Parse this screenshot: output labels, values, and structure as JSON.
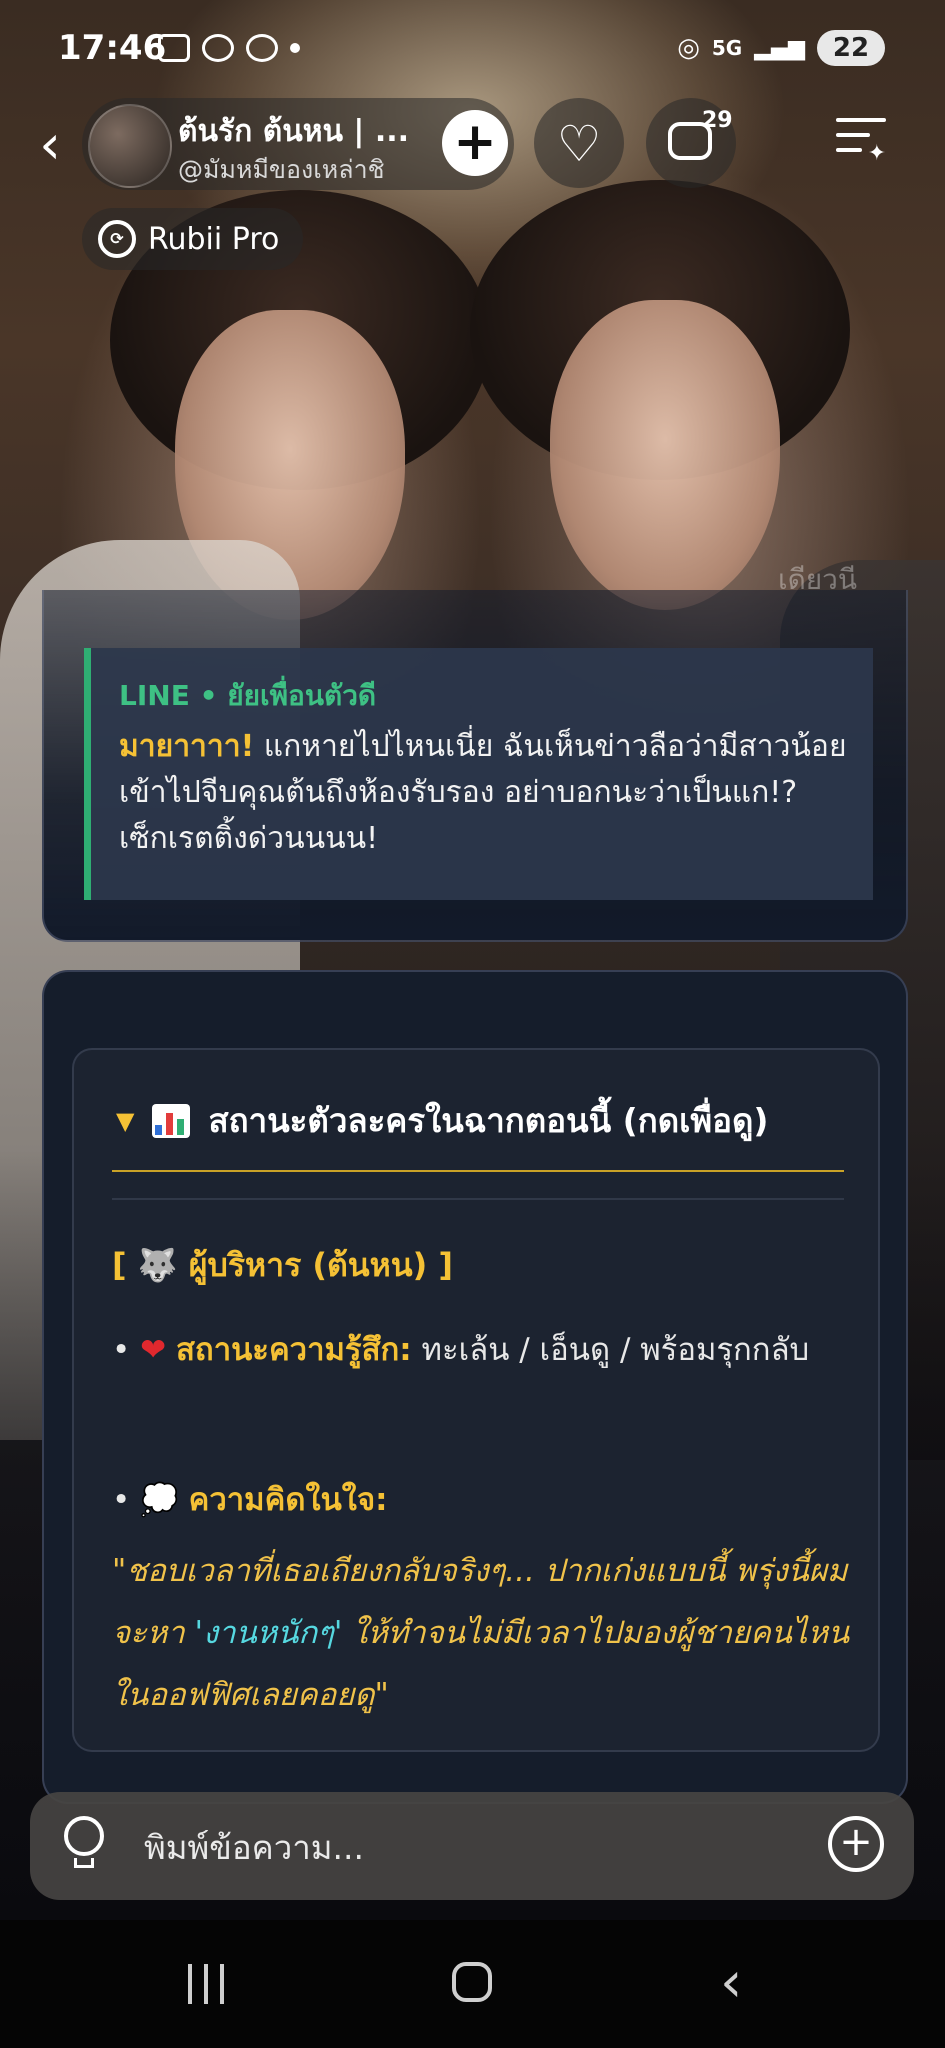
{
  "status_bar": {
    "time": "17:46",
    "network": "5G",
    "battery": "22"
  },
  "header": {
    "back_glyph": "‹",
    "character_name": "ต้นรัก ต้นหน | ...",
    "creator_handle": "@มัมหมีของเหล่าชิ",
    "add_glyph": "+",
    "comment_count": "29",
    "badge_label": "Rubii Pro"
  },
  "watermark": "เดียวนี",
  "message_card": {
    "quote_header": "LINE • ยัยเพื่อนตัวดี",
    "quote_emphasis": "มายาาาา!",
    "quote_body": " แกหายไปไหนเนี่ย ฉันเห็นข่าวลือว่ามีสาวน้อยเข้าไปจีบคุณต้นถึงห้องรับรอง อย่าบอกนะว่าเป็นแก!? เซ็กเรตติ้งด่วนนนน!"
  },
  "status_card": {
    "summary_label": "สถานะตัวละครในฉากตอนนี้ (กดเพื่อดู)",
    "role_line": "[ 🐺 ผู้บริหาร (ต้นหน) ]",
    "bullet": "•",
    "feeling_label": "สถานะความรู้สึก:",
    "feeling_value": " ทะเล้น / เอ็นดู / พร้อมรุกกลับ",
    "thought_label": "ความคิดในใจ:",
    "thought_part1": "\"ชอบเวลาที่เธอเถียงกลับจริงๆ... ปากเก่งแบบนี้ พรุ่งนี้ผมจะหา ",
    "thought_part2": "'งานหนักๆ'",
    "thought_part3": " ให้ทำจนไม่มีเวลาไปมองผู้ชายคนไหนในออฟฟิศเลยคอยดู\""
  },
  "composer": {
    "placeholder": "พิมพ์ข้อความ...",
    "add_glyph": "+"
  },
  "colors": {
    "accent_gold": "#f5c135",
    "line_green": "#3ec184",
    "thought_cyan": "#56d8e0"
  }
}
